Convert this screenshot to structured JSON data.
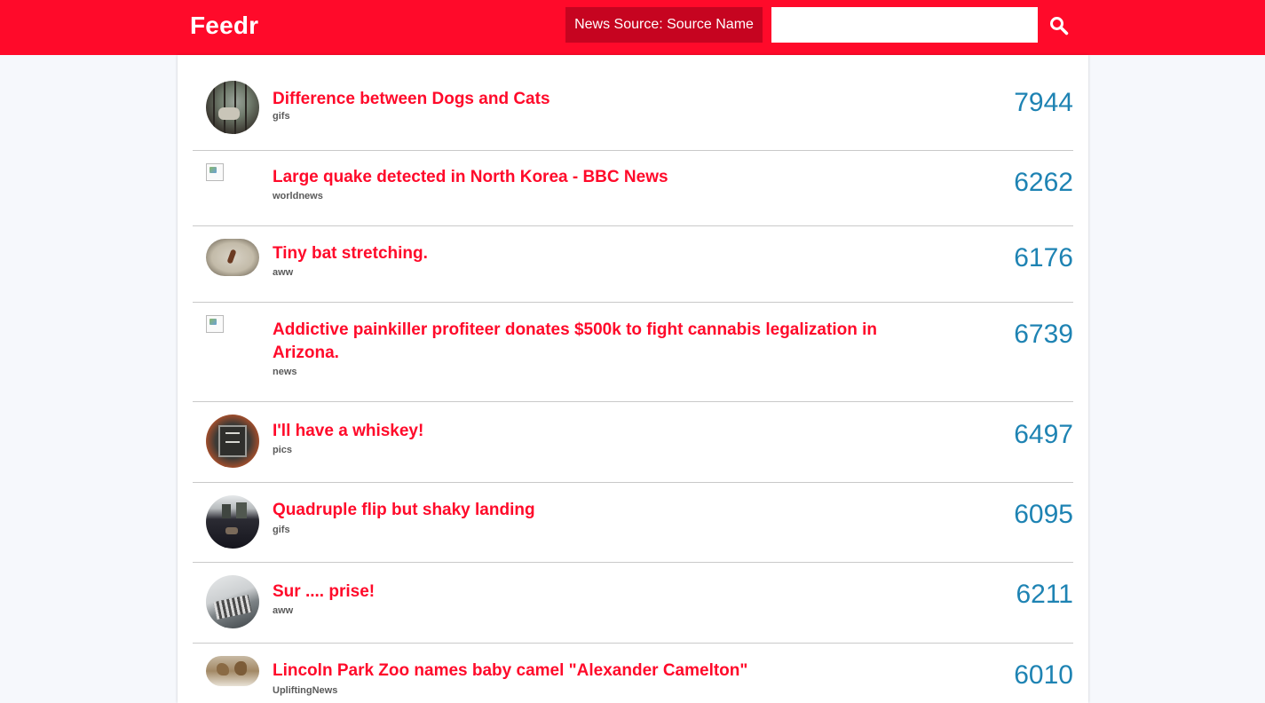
{
  "header": {
    "logo": "Feedr",
    "source_button": "News Source: Source Name",
    "search_value": "",
    "search_icon": "search-icon",
    "accent_color": "#ff0a2a"
  },
  "articles": [
    {
      "title": "Difference between Dogs and Cats",
      "category": "gifs",
      "count": "7944",
      "thumb": "circle"
    },
    {
      "title": "Large quake detected in North Korea - BBC News",
      "category": "worldnews",
      "count": "6262",
      "thumb": "broken"
    },
    {
      "title": "Tiny bat stretching.",
      "category": "aww",
      "count": "6176",
      "thumb": "circle"
    },
    {
      "title": "Addictive painkiller profiteer donates $500k to fight cannabis legalization in Arizona.",
      "category": "news",
      "count": "6739",
      "thumb": "broken"
    },
    {
      "title": "I'll have a whiskey!",
      "category": "pics",
      "count": "6497",
      "thumb": "circle"
    },
    {
      "title": "Quadruple flip but shaky landing",
      "category": "gifs",
      "count": "6095",
      "thumb": "circle"
    },
    {
      "title": "Sur .... prise!",
      "category": "aww",
      "count": "6211",
      "thumb": "circle"
    },
    {
      "title": "Lincoln Park Zoo names baby camel \"Alexander Camelton\"",
      "category": "UpliftingNews",
      "count": "6010",
      "thumb": "circle"
    }
  ]
}
